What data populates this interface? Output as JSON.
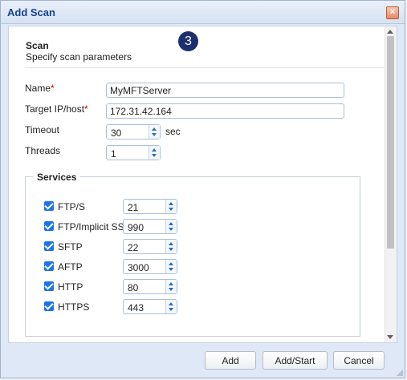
{
  "dialog": {
    "title": "Add Scan",
    "close_icon": "close-icon",
    "step_number": "3"
  },
  "section": {
    "title": "Scan",
    "subtitle": "Specify scan parameters"
  },
  "form": {
    "name_label": "Name",
    "name_value": "MyMFTServer",
    "target_label": "Target IP/host",
    "target_value": "172.31.42.164",
    "required_marker": "*",
    "timeout_label": "Timeout",
    "timeout_value": "30",
    "timeout_unit": "sec",
    "threads_label": "Threads",
    "threads_value": "1"
  },
  "services": {
    "legend": "Services",
    "items": [
      {
        "label": "FTP/S",
        "checked": true,
        "port": "21"
      },
      {
        "label": "FTP/Implicit SSL",
        "checked": true,
        "port": "990"
      },
      {
        "label": "SFTP",
        "checked": true,
        "port": "22"
      },
      {
        "label": "AFTP",
        "checked": true,
        "port": "3000"
      },
      {
        "label": "HTTP",
        "checked": true,
        "port": "80"
      },
      {
        "label": "HTTPS",
        "checked": true,
        "port": "443"
      }
    ]
  },
  "buttons": {
    "add": "Add",
    "add_start": "Add/Start",
    "cancel": "Cancel"
  },
  "colors": {
    "accent": "#1a73e8",
    "title_text": "#15428b",
    "step_badge": "#1d2f6e",
    "required": "#cc0000"
  }
}
